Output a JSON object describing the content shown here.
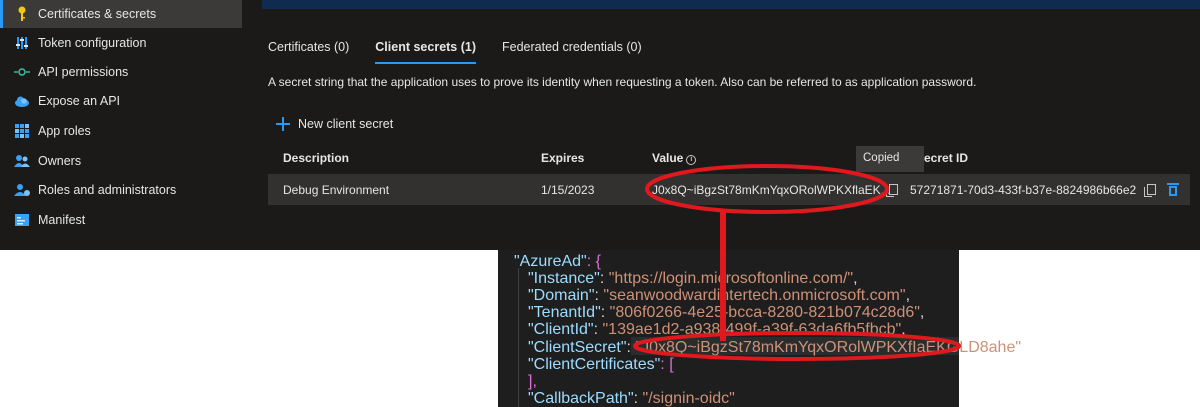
{
  "sidebar": {
    "items": [
      {
        "label": "Certificates & secrets",
        "icon": "key-icon"
      },
      {
        "label": "Token configuration",
        "icon": "sliders-icon"
      },
      {
        "label": "API permissions",
        "icon": "api-icon"
      },
      {
        "label": "Expose an API",
        "icon": "cloud-icon"
      },
      {
        "label": "App roles",
        "icon": "grid-icon"
      },
      {
        "label": "Owners",
        "icon": "people-icon"
      },
      {
        "label": "Roles and administrators",
        "icon": "person-badge-icon"
      },
      {
        "label": "Manifest",
        "icon": "manifest-icon"
      }
    ]
  },
  "tabs": [
    {
      "label": "Certificates (0)"
    },
    {
      "label": "Client secrets (1)"
    },
    {
      "label": "Federated credentials (0)"
    }
  ],
  "description": "A secret string that the application uses to prove its identity when requesting a token. Also can be referred to as application password.",
  "new_secret_label": "New client secret",
  "table": {
    "headers": {
      "description": "Description",
      "expires": "Expires",
      "value": "Value",
      "secret_id": "ecret ID"
    },
    "row": {
      "description": "Debug Environment",
      "expires": "1/15/2023",
      "value": "J0x8Q~iBgzSt78mKmYqxORolWPKXflaEK...",
      "secret_id": "57271871-70d3-433f-b37e-8824986b66e2"
    },
    "tooltip": "Copied"
  },
  "code": {
    "lines": [
      {
        "key": "\"AzureAd\"",
        "rest": ": {"
      },
      {
        "key": "\"Instance\"",
        "value": "\"https://login.microsoftonline.com/\"",
        "tail": ","
      },
      {
        "key": "\"Domain\"",
        "value": "\"seanwoodwardintertech.onmicrosoft.com\"",
        "tail": ","
      },
      {
        "key": "\"TenantId\"",
        "value": "\"806f0266-4e25-bcca-8280-821b074c28d6\"",
        "tail": ","
      },
      {
        "key": "\"ClientId\"",
        "value": "\"139ae1d2-a938-499f-a39f-63da6fb5fbcb\"",
        "tail": ","
      },
      {
        "key": "\"ClientSecret\"",
        "value": "\"J0x8Q~iBgzSt78mKmYqxORolWPKXfIaEKGLD8ahe\"",
        "tail": ""
      },
      {
        "key": "\"ClientCertificates\"",
        "rest": ": ["
      },
      {
        "rest": "],"
      },
      {
        "key": "\"CallbackPath\"",
        "value": "\"/signin-oidc\"",
        "tail": ""
      }
    ]
  },
  "colors": {
    "accent": "#2899f5",
    "annotation": "#e0191e",
    "portal_bg": "#1b1a19",
    "editor_bg": "#1e1e1e"
  }
}
